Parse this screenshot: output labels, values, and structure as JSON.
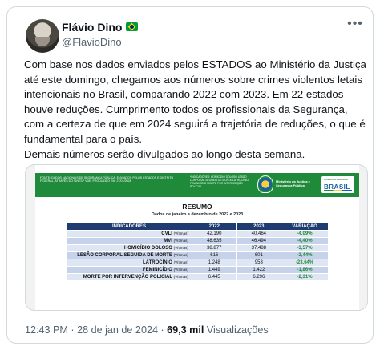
{
  "author": {
    "name": "Flávio Dino",
    "handle": "@FlavioDino",
    "flag": "brazil-flag-icon"
  },
  "tweet": {
    "paragraph1": "Com base nos dados enviados pelos ESTADOS ao Ministério da Justiça até este domingo, chegamos aos números sobre crimes violentos letais intencionais no Brasil, comparando 2022 com 2023. Em 22 estados houve reduções. Cumprimento todos os profissionais da Segurança, com a certeza de que em 2024 seguirá a trajetória de reduções, o que é fundamental para o país.",
    "paragraph2": "Demais números serão divulgados ao longo desta semana."
  },
  "document": {
    "header_left": "FONTE: DADOS NACIONAIS DE SEGURANÇA PÚBLICA, ENVIADOS PELOS ESTADOS E DISTRITO FEDERAL, ATRAVÉS DO SINESP VDE. PRODUZIDO EM: 27/01/2024",
    "header_mid": "*INDICADORES: HOMICÍDIO DOLOSO LESÃO CORPORAL SEGUIDA DE MORTE LATROCÍNIO FEMINICÍDIO MORTE POR INTERVENÇÃO POLICIAL",
    "ministry": "Ministério da Justiça e Segurança Pública",
    "gov_top": "GOVERNO FEDERAL",
    "gov_brand": "BRASIL",
    "title": "RESUMO",
    "subtitle": "Dados de janeiro a dezembro de 2022 e 2023",
    "table": {
      "headers": [
        "INDICADORES",
        "2022",
        "2023",
        "VARIAÇÃO"
      ],
      "rows": [
        {
          "indicator": "CVLI",
          "unit": "(Vítimas)",
          "y2022": "42.190",
          "y2023": "40.464",
          "variation": "-4,09%"
        },
        {
          "indicator": "MVI",
          "unit": "(Vítimas)",
          "y2022": "48.635",
          "y2023": "46.494",
          "variation": "-4,40%"
        },
        {
          "indicator": "HOMICÍDIO DOLOSO",
          "unit": "(Vítimas)",
          "y2022": "38.877",
          "y2023": "37.488",
          "variation": "-3,57%"
        },
        {
          "indicator": "LESÃO CORPORAL SEGUIDA DE MORTE",
          "unit": "(Vítimas)",
          "y2022": "616",
          "y2023": "601",
          "variation": "-2,44%"
        },
        {
          "indicator": "LATROCÍNIO",
          "unit": "(Vítimas)",
          "y2022": "1.248",
          "y2023": "953",
          "variation": "-23,64%"
        },
        {
          "indicator": "FEMINICÍDIO",
          "unit": "(Vítimas)",
          "y2022": "1.449",
          "y2023": "1.422",
          "variation": "-1,86%"
        },
        {
          "indicator": "MORTE POR INTERVENÇÃO POLICIAL",
          "unit": "(Vítimas)",
          "y2022": "6.445",
          "y2023": "6.296",
          "variation": "-2,31%"
        }
      ]
    }
  },
  "meta": {
    "time": "12:43 PM",
    "date": "28 de jan de 2024",
    "views_count": "69,3 mil",
    "views_label": "Visualizações"
  },
  "colors": {
    "header_green": "#1f8a3a",
    "table_header": "#1e3c72",
    "variation_green": "#1f8a3a",
    "muted_text": "#536471"
  }
}
